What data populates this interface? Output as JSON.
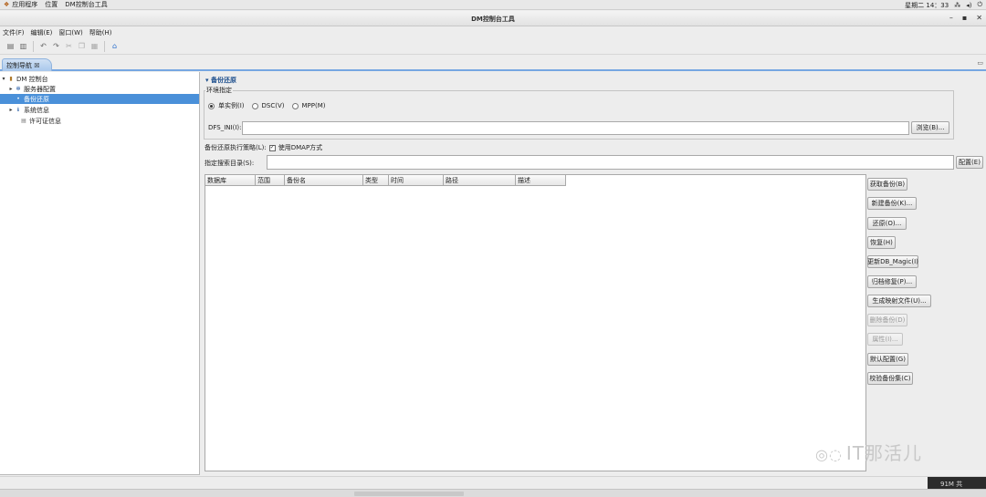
{
  "topbar": {
    "apps_label": "应用程序",
    "places_label": "位置",
    "active_app_label": "DM控制台工具",
    "clock": "星期二 14：33"
  },
  "window": {
    "title": "DM控制台工具"
  },
  "menubar": {
    "items": [
      "文件(F)",
      "编辑(E)",
      "窗口(W)",
      "帮助(H)"
    ]
  },
  "nav_tab": {
    "label": "控制导航 ☒"
  },
  "tree": {
    "root": "DM 控制台",
    "items": [
      {
        "label": "服务器配置",
        "icon": "gear-icon"
      },
      {
        "label": "备份还原",
        "icon": "backup-icon",
        "selected": true
      },
      {
        "label": "系统信息",
        "icon": "info-icon"
      },
      {
        "label": "许可证信息",
        "icon": "license-icon"
      }
    ]
  },
  "main": {
    "section_title": "备份还原",
    "env_group_label": "环境指定",
    "env_options": [
      {
        "label": "单实例(I)",
        "checked": true
      },
      {
        "label": "DSC(V)",
        "checked": false
      },
      {
        "label": "MPP(M)",
        "checked": false
      }
    ],
    "dfs_label": "DFS_INI(I):",
    "dfs_value": "",
    "browse_label": "浏览(B)...",
    "strategy_label": "备份还原执行策略(L):",
    "dmap_label": "使用DMAP方式",
    "dmap_checked": true,
    "search_label": "指定搜索目录(S):",
    "search_value": "",
    "config_label": "配置(E)"
  },
  "table": {
    "columns": [
      "数据库",
      "范围",
      "备份名",
      "类型",
      "时间",
      "路径",
      "描述"
    ],
    "rows": []
  },
  "actions": [
    {
      "label": "获取备份(B)",
      "enabled": true
    },
    {
      "label": "新建备份(K)...",
      "enabled": true
    },
    {
      "label": "还原(O)...",
      "enabled": true
    },
    {
      "label": "恢复(H)",
      "enabled": true
    },
    {
      "label": "更新DB_Magic(I)",
      "enabled": true
    },
    {
      "label": "归档修复(P)...",
      "enabled": true
    },
    {
      "label": "生成映射文件(U)...",
      "enabled": true
    },
    {
      "label": "删除备份(D)",
      "enabled": false
    },
    {
      "label": "属性(I)...",
      "enabled": false
    },
    {
      "label": "默认配置(G)",
      "enabled": true
    },
    {
      "label": "校验备份集(C)",
      "enabled": true
    }
  ],
  "watermark": "IT那活儿",
  "status": {
    "memory": "91M 共"
  },
  "colors": {
    "selection": "#4a90d9",
    "tab_accent": "#76a7e2",
    "section_title": "#1b4d8c"
  }
}
